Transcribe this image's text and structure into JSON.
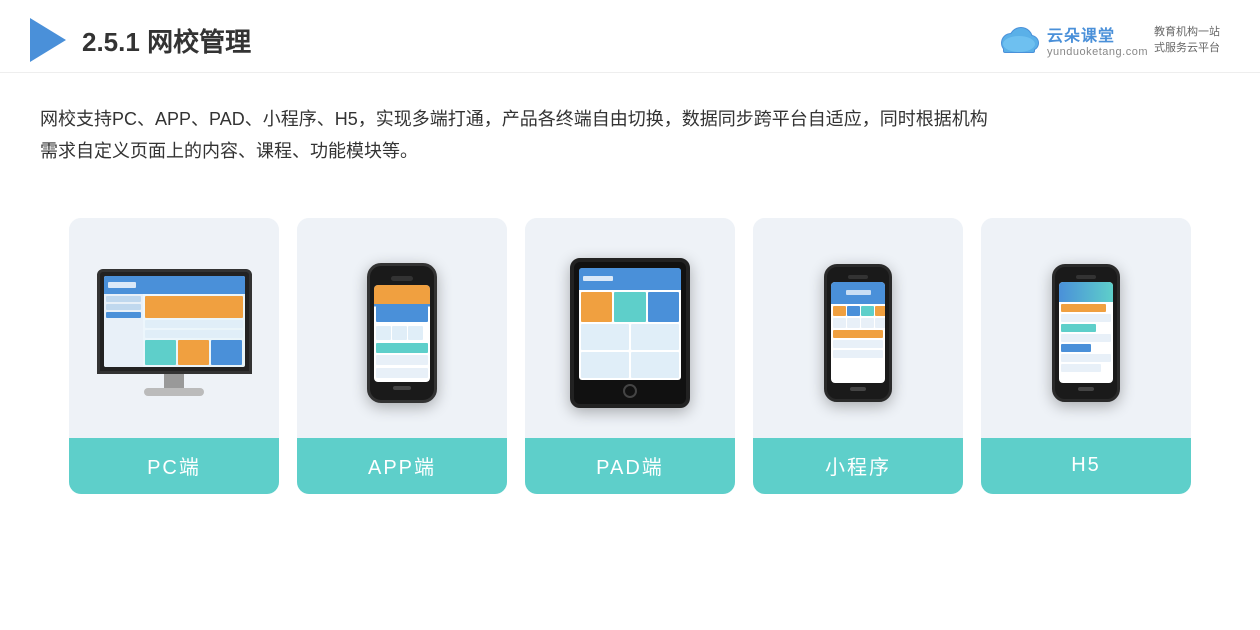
{
  "header": {
    "section_number": "2.5.1",
    "title_plain": "网校管理",
    "logo_url": "yunduoketang.com",
    "logo_name": "云朵课堂",
    "logo_slogan_line1": "教育机构一站",
    "logo_slogan_line2": "式服务云平台"
  },
  "description": {
    "text_line1": "网校支持PC、APP、PAD、小程序、H5，实现多端打通，产品各终端自由切换，数据同步跨平台自适应，同时根据机构",
    "text_line2": "需求自定义页面上的内容、课程、功能模块等。"
  },
  "cards": [
    {
      "id": "pc",
      "label": "PC端"
    },
    {
      "id": "app",
      "label": "APP端"
    },
    {
      "id": "pad",
      "label": "PAD端"
    },
    {
      "id": "miniapp",
      "label": "小程序"
    },
    {
      "id": "h5",
      "label": "H5"
    }
  ],
  "colors": {
    "accent_teal": "#5ecfca",
    "accent_blue": "#4a90d9",
    "accent_orange": "#f0a040",
    "card_bg": "#eef2f7",
    "text_dark": "#333333"
  }
}
